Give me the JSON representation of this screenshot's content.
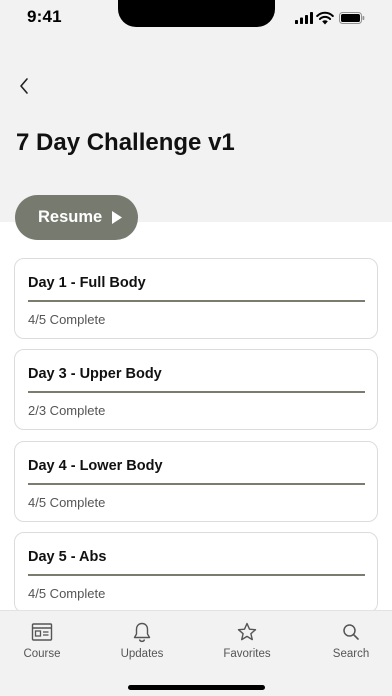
{
  "status_bar": {
    "time": "9:41"
  },
  "header": {
    "title": "7 Day Challenge v1"
  },
  "resume_button": {
    "label": "Resume"
  },
  "days": [
    {
      "title": "Day 1 - Full Body",
      "status": "4/5 Complete",
      "progress": 1.0
    },
    {
      "title": "Day 3 - Upper Body",
      "status": "2/3 Complete",
      "progress": 1.0
    },
    {
      "title": "Day 4 - Lower Body",
      "status": "4/5 Complete",
      "progress": 1.0
    },
    {
      "title": "Day 5 - Abs",
      "status": "4/5 Complete",
      "progress": 1.0
    }
  ],
  "tab_bar": {
    "tabs": [
      {
        "label": "Course",
        "icon": "course-icon"
      },
      {
        "label": "Updates",
        "icon": "bell-icon"
      },
      {
        "label": "Favorites",
        "icon": "star-icon"
      },
      {
        "label": "Search",
        "icon": "search-icon"
      }
    ]
  },
  "colors": {
    "accent": "#777b6f",
    "header_bg": "#f2f2f2",
    "progress": "#7a7c70"
  }
}
